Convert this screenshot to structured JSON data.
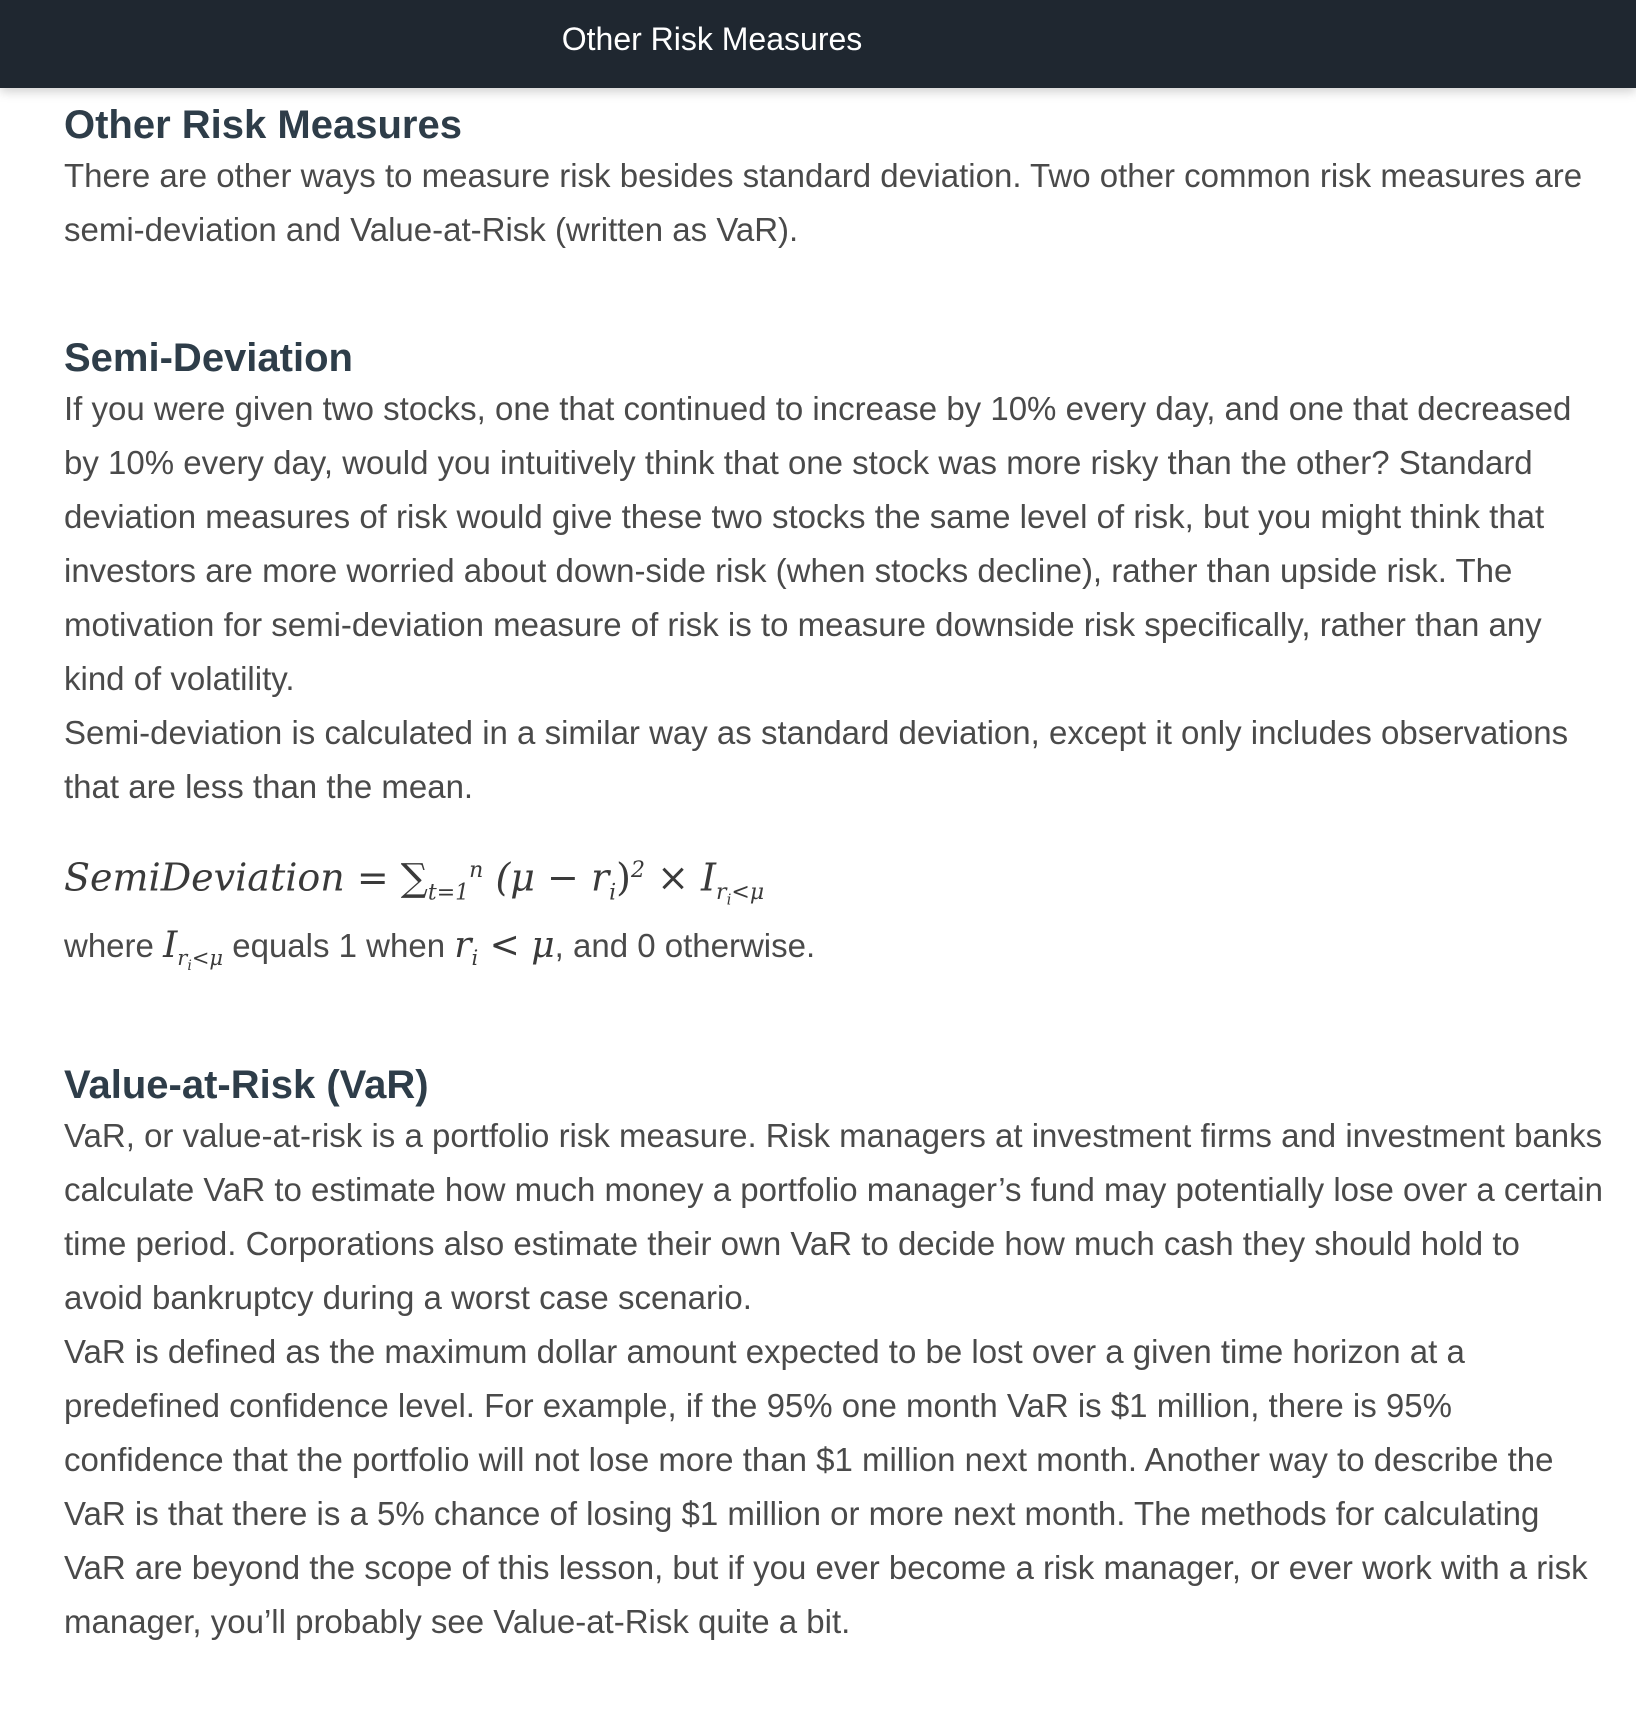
{
  "header": {
    "title": "Other Risk Measures"
  },
  "main": {
    "page_title": "Other Risk Measures",
    "intro": "There are other ways to measure risk besides standard deviation. Two other common risk measures are semi-deviation and Value-at-Risk (written as VaR).",
    "semi_deviation": {
      "heading": "Semi-Deviation",
      "paragraph_1": "If you were given two stocks, one that continued to increase by 10% every day, and one that decreased by 10% every day, would you intuitively think that one stock was more risky than the other? Standard deviation measures of risk would give these two stocks the same level of risk, but you might think that investors are more worried about down-side risk (when stocks decline), rather than upside risk. The motivation for semi-deviation measure of risk is to measure downside risk specifically, rather than any kind of volatility.",
      "paragraph_2": "Semi-deviation is calculated in a similar way as standard deviation, except it only includes observations that are less than the mean.",
      "formula": {
        "lhs": "SemiDeviation",
        "equals": "=",
        "sum_symbol": "∑",
        "sum_sub": "t=1",
        "sum_sup": "n",
        "body_open": "(μ − r",
        "body_r_sub": "i",
        "body_close": ")",
        "body_exp": "2",
        "times": "×",
        "indicator": "I",
        "indicator_sub": "r",
        "indicator_sub_sub": "i",
        "indicator_sub_rest": "<μ"
      },
      "where": {
        "prefix": "where",
        "indicator": "I",
        "indicator_sub": "r",
        "indicator_sub_sub": "i",
        "indicator_sub_rest": "<μ",
        "middle": "equals 1 when",
        "cond_var": "r",
        "cond_var_sub": "i",
        "cond_rest": "< μ",
        "suffix": ", and 0 otherwise."
      }
    },
    "value_at_risk": {
      "heading": "Value-at-Risk (VaR)",
      "paragraph_1": "VaR, or value-at-risk is a portfolio risk measure. Risk managers at investment firms and investment banks calculate VaR to estimate how much money a portfolio manager’s fund may potentially lose over a certain time period. Corporations also estimate their own VaR to decide how much cash they should hold to avoid bankruptcy during a worst case scenario.",
      "paragraph_2": "VaR is defined as the maximum dollar amount expected to be lost over a given time horizon at a predefined confidence level. For example, if the 95% one month VaR is $1 million, there is 95% confidence that the portfolio will not lose more than $1 million next month. Another way to describe the VaR is that there is a 5% chance of losing $1 million or more next month. The methods for calculating VaR are beyond the scope of this lesson, but if you ever become a risk manager, or ever work with a risk manager, you’ll probably see Value-at-Risk quite a bit."
    }
  },
  "colors": {
    "header_bg": "#1f2730",
    "header_text": "#ffffff",
    "heading_text": "#2e3d49",
    "body_text": "#4a4a4a"
  }
}
